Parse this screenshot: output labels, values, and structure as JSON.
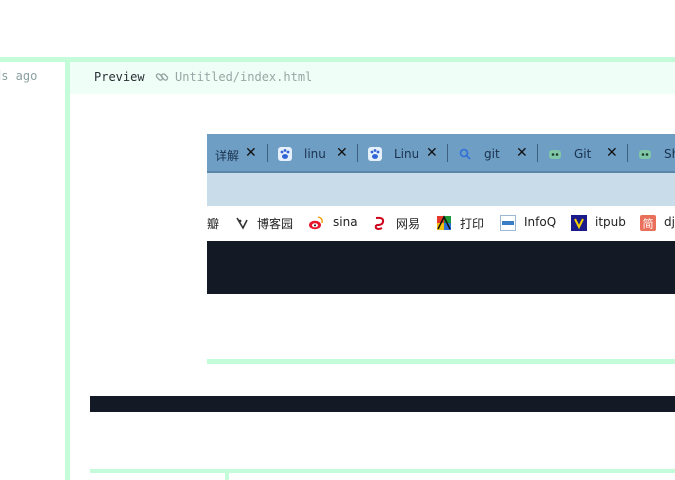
{
  "editor": {
    "left_status": "ds ago",
    "preview_label": "Preview",
    "file_path": "Untitled/index.html",
    "link_icon": "link-icon"
  },
  "browser_tabs": [
    {
      "label": "详解",
      "icon": "blank"
    },
    {
      "label": "linux",
      "icon": "baidu-paw-icon"
    },
    {
      "label": "Linu",
      "icon": "baidu-paw-icon"
    },
    {
      "label": "git",
      "icon": "search-icon"
    },
    {
      "label": "Git",
      "icon": "robot-icon"
    },
    {
      "label": "Sh",
      "icon": "robot-icon"
    }
  ],
  "bookmarks": [
    {
      "label": "瓣",
      "icon": ""
    },
    {
      "label": "博客园",
      "icon": "cnblogs-icon"
    },
    {
      "label": "sina",
      "icon": "weibo-icon"
    },
    {
      "label": "网易",
      "icon": "netease-icon"
    },
    {
      "label": "打印",
      "icon": "print-icon"
    },
    {
      "label": "InfoQ",
      "icon": "infoq-icon"
    },
    {
      "label": "itpub",
      "icon": "itpub-icon"
    },
    {
      "label": "dj",
      "icon": "jianshu-icon"
    }
  ],
  "colors": {
    "accent_green": "#c4fcd9",
    "header_bg": "#effef6",
    "tab_strip": "#6f9ec5",
    "dark": "#131925"
  }
}
